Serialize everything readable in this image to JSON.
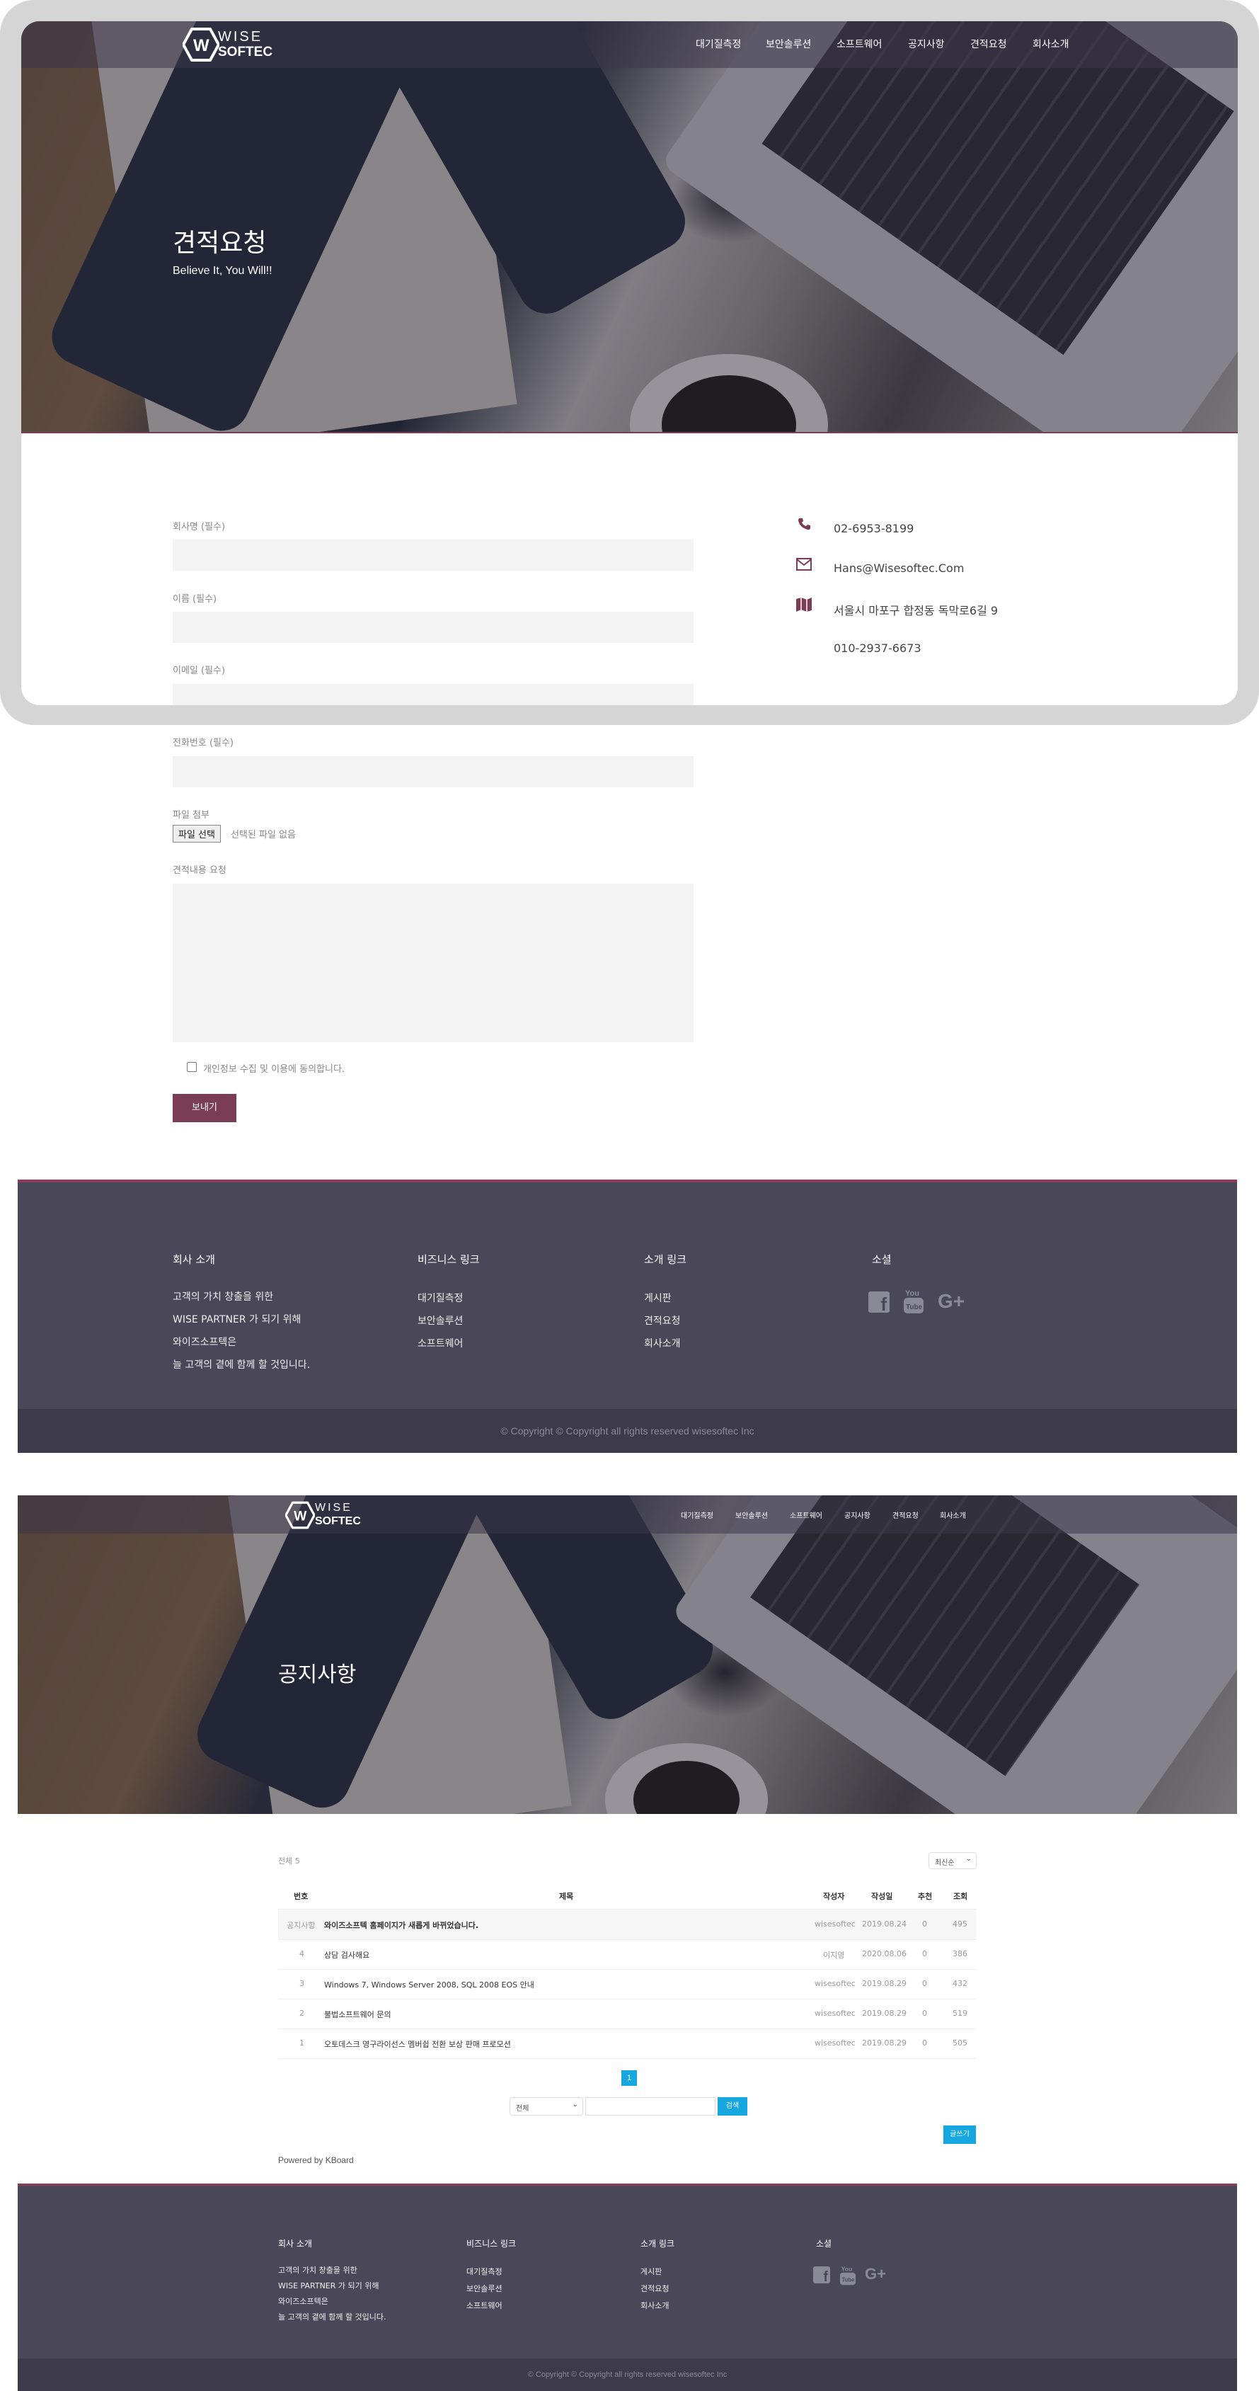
{
  "quote_page": {
    "logo": {
      "top": "WISE",
      "bottom": "SOFTEC"
    },
    "nav": [
      "대기질측정",
      "보안솔루션",
      "소프트웨어",
      "공지사항",
      "견적요청",
      "회사소개"
    ],
    "hero_title": "견적요청",
    "hero_subtitle": "Believe It, You Will!!",
    "form": {
      "company_label": "회사명 (필수)",
      "name_label": "이름 (필수)",
      "email_label": "이메일 (필수)",
      "phone_label": "전화번호 (필수)",
      "file_label": "파일 첨부",
      "file_button": "파일 선택",
      "file_status": "선택된 파일 없음",
      "request_label": "견적내용 요청",
      "consent_label": "개인정보 수집 및 이용에 동의합니다.",
      "submit_label": "보내기"
    },
    "contact": {
      "phone": "02-6953-8199",
      "email": "Hans@Wisesoftec.Com",
      "address": "서울시 마포구 합정동 독막로6길 9",
      "mobile": "010-2937-6673"
    }
  },
  "footer": {
    "about_title": "회사 소개",
    "about_lines": [
      "고객의 가치 창출을 위한",
      "WISE PARTNER 가 되기 위해",
      "와이즈소프텍은",
      "늘 고객의 곁에 함께 할 것입니다."
    ],
    "business_title": "비즈니스 링크",
    "business_links": [
      "대기질측정",
      "보안솔루션",
      "소프트웨어"
    ],
    "intro_title": "소개 링크",
    "intro_links": [
      "게시판",
      "견적요청",
      "회사소개"
    ],
    "social_title": "소셜",
    "social_icons": [
      "facebook-icon",
      "youtube-icon",
      "google-plus-icon"
    ],
    "copyright": "© Copyright © Copyright all rights reserved wisesoftec Inc"
  },
  "notice_page": {
    "hero_title": "공지사항",
    "total": "전체 5",
    "sort": "최신순",
    "columns": [
      "번호",
      "제목",
      "작성자",
      "작성일",
      "추천",
      "조회"
    ],
    "rows": [
      {
        "num": "공지사항",
        "title": "와이즈소프텍 홈페이지가 새롭게 바뀌었습니다.",
        "author": "wisesoftec",
        "date": "2019.08.24",
        "likes": "0",
        "views": "495"
      },
      {
        "num": "4",
        "title": "상담 검사해요",
        "author": "이지영",
        "date": "2020.08.06",
        "likes": "0",
        "views": "386"
      },
      {
        "num": "3",
        "title": "Windows 7, Windows Server 2008, SQL 2008 EOS 안내",
        "author": "wisesoftec",
        "date": "2019.08.29",
        "likes": "0",
        "views": "432"
      },
      {
        "num": "2",
        "title": "불법소프트웨어 문의",
        "author": "wisesoftec",
        "date": "2019.08.29",
        "likes": "0",
        "views": "519"
      },
      {
        "num": "1",
        "title": "오토데스크 영구라이선스 멤버쉽 전환 보상 판매 프로모션",
        "author": "wisesoftec",
        "date": "2019.08.29",
        "likes": "0",
        "views": "505"
      }
    ],
    "page": "1",
    "search_select": "전체",
    "search_button": "검색",
    "write_button": "글쓰기",
    "powered_by": "Powered by KBoard"
  },
  "colors": {
    "accent": "#7a3d55",
    "footer": "#4a4858",
    "blue": "#16a7e0"
  }
}
